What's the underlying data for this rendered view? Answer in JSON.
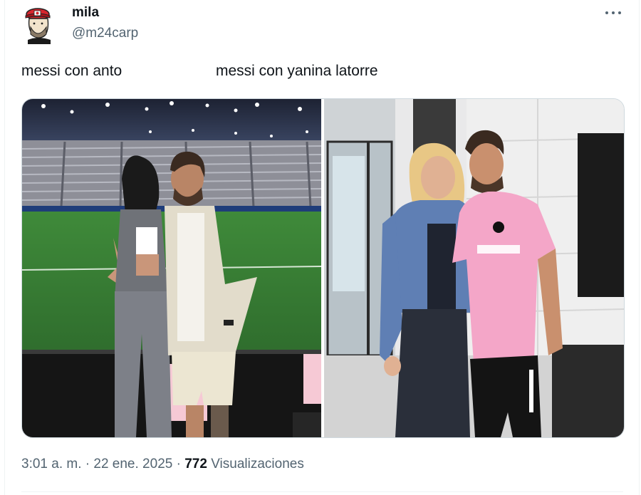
{
  "post": {
    "author": {
      "display_name": "mila",
      "handle": "@m24carp",
      "avatar_icon": "cartoon-avatar-red-cap-icon"
    },
    "more_icon": "more-options-icon",
    "captions": {
      "left": "messi con anto",
      "right": "messi con yanina latorre"
    },
    "images": [
      {
        "name": "photo-messi-anto"
      },
      {
        "name": "photo-messi-yanina"
      }
    ],
    "meta": {
      "time": "3:01 a. m.",
      "separator1": " · ",
      "date": "22 ene. 2025",
      "separator2": " · ",
      "views_count": "772",
      "views_label": " Visualizaciones"
    }
  },
  "colors": {
    "text_primary": "#0f1419",
    "text_secondary": "#536471",
    "border": "#cfd9de",
    "jersey_pink": "#f4a6c8"
  }
}
